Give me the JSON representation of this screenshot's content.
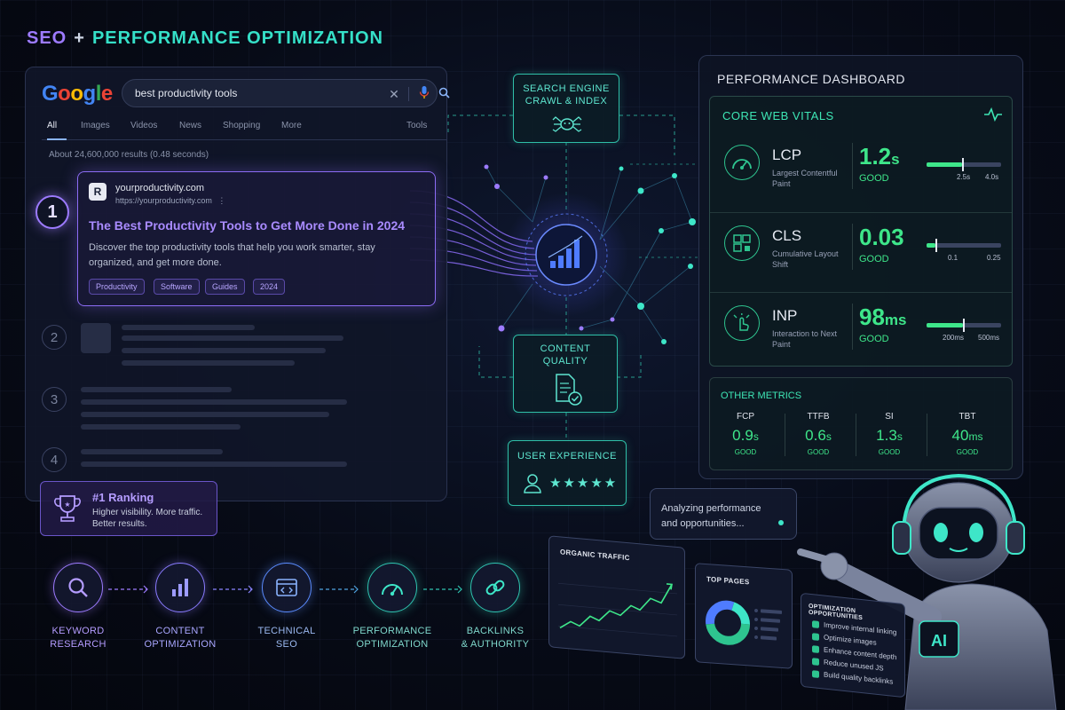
{
  "header": {
    "title_part1": "SEO",
    "title_plus": "+",
    "title_part2": "PERFORMANCE OPTIMIZATION"
  },
  "search": {
    "logo": "Google",
    "query": "best productivity tools",
    "tabs": [
      "All",
      "Images",
      "Videos",
      "News",
      "Shopping",
      "More",
      "Tools"
    ],
    "result_count": "About 24,600,000 results (0.48 seconds)",
    "top_result": {
      "rank": "1",
      "site_initial": "R",
      "site_name": "yourproductivity.com",
      "url": "https://yourproductivity.com",
      "menu": "⋮",
      "title": "The Best Productivity Tools to Get More Done in 2024",
      "description": "Discover the top productivity tools that help you work smarter, stay organized, and get more done.",
      "tags": [
        "Productivity",
        "Software",
        "Guides",
        "2024"
      ]
    },
    "other_ranks": [
      "2",
      "3",
      "4"
    ],
    "ranking_badge": {
      "title": "#1 Ranking",
      "description": "Higher visibility. More traffic. Better results."
    }
  },
  "center": {
    "crawl_label_1": "SEARCH ENGINE",
    "crawl_label_2": "CRAWL & INDEX",
    "quality_label_1": "CONTENT",
    "quality_label_2": "QUALITY",
    "ux_label": "USER EXPERIENCE",
    "ux_stars": "★★★★★"
  },
  "dashboard": {
    "title": "PERFORMANCE DASHBOARD",
    "cwv_title": "CORE WEB VITALS",
    "metrics": [
      {
        "name": "LCP",
        "desc": "Largest Contentful Paint",
        "value": "1.2",
        "unit": "s",
        "status": "GOOD",
        "tick1": "2.5s",
        "tick2": "4.0s",
        "marker": 0.48
      },
      {
        "name": "CLS",
        "desc": "Cumulative Layout Shift",
        "value": "0.03",
        "unit": "",
        "status": "GOOD",
        "tick1": "0.1",
        "tick2": "0.25",
        "marker": 0.12
      },
      {
        "name": "INP",
        "desc": "Interaction to Next Paint",
        "value": "98",
        "unit": "ms",
        "status": "GOOD",
        "tick1": "200ms",
        "tick2": "500ms",
        "marker": 0.49
      }
    ],
    "other_title": "OTHER METRICS",
    "other_metrics": [
      {
        "name": "FCP",
        "value": "0.9",
        "unit": "s",
        "status": "GOOD"
      },
      {
        "name": "TTFB",
        "value": "0.6",
        "unit": "s",
        "status": "GOOD"
      },
      {
        "name": "SI",
        "value": "1.3",
        "unit": "s",
        "status": "GOOD"
      },
      {
        "name": "TBT",
        "value": "40",
        "unit": "ms",
        "status": "GOOD"
      }
    ]
  },
  "workflow": [
    {
      "line1": "KEYWORD",
      "line2": "RESEARCH",
      "icon": "search-icon",
      "color": "#9d7bff"
    },
    {
      "line1": "CONTENT",
      "line2": "OPTIMIZATION",
      "icon": "bar-chart-icon",
      "color": "#9d7bff"
    },
    {
      "line1": "TECHNICAL",
      "line2": "SEO",
      "icon": "code-window-icon",
      "color": "#5b8cff"
    },
    {
      "line1": "PERFORMANCE",
      "line2": "OPTIMIZATION",
      "icon": "speedometer-icon",
      "color": "#2fc4b0"
    },
    {
      "line1": "BACKLINKS",
      "line2": "& AUTHORITY",
      "icon": "link-icon",
      "color": "#2fc4b0"
    }
  ],
  "analytics": {
    "speech": "Analyzing performance and opportunities...",
    "organic_title": "ORGANIC TRAFFIC",
    "top_pages_title": "TOP PAGES",
    "opp_title": "OPTIMIZATION OPPORTUNITIES",
    "opportunities": [
      "Improve internal linking",
      "Optimize images",
      "Enhance content depth",
      "Reduce unused JS",
      "Build quality backlinks"
    ],
    "robot_badge": "AI"
  }
}
